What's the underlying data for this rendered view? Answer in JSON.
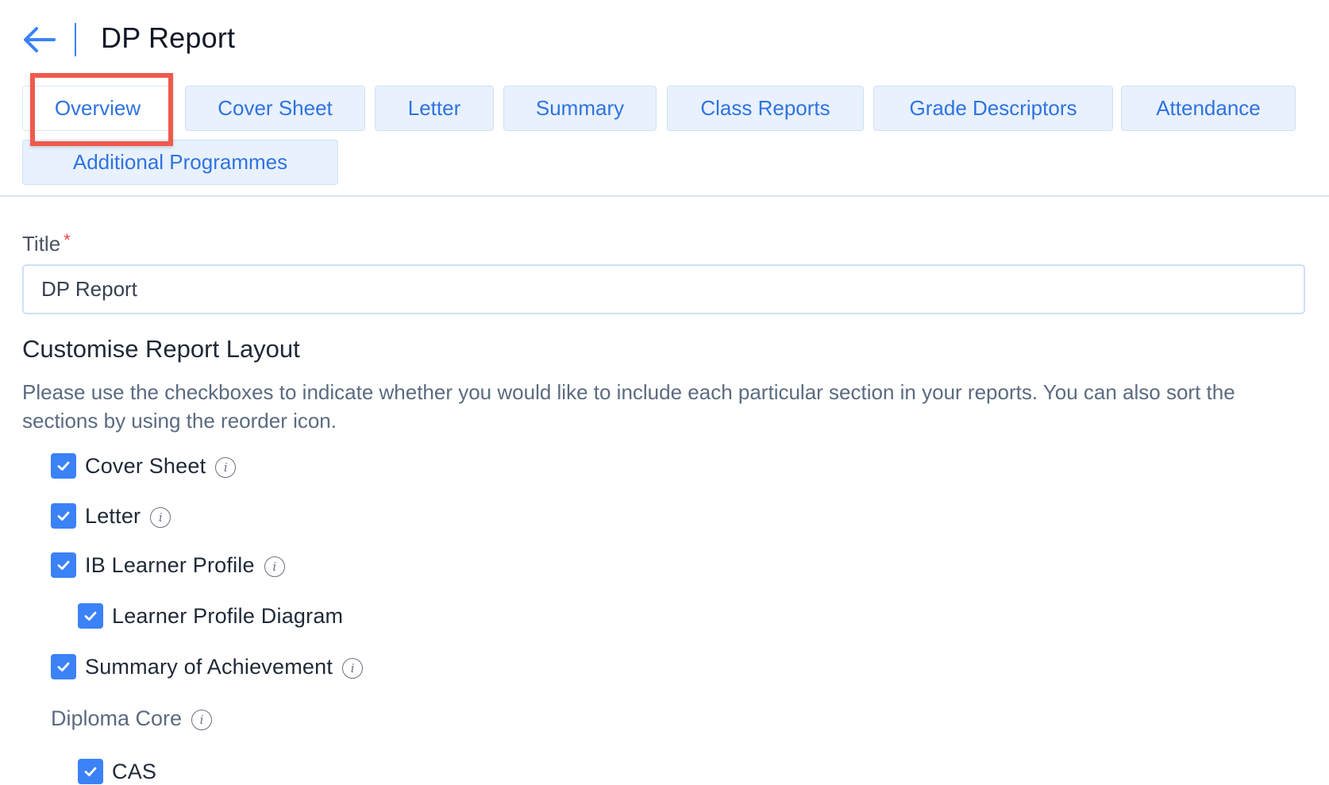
{
  "header": {
    "back_icon": "arrow-left-icon",
    "title": "DP Report"
  },
  "tabs": [
    {
      "label": "Overview",
      "active": true
    },
    {
      "label": "Cover Sheet",
      "active": false
    },
    {
      "label": "Letter",
      "active": false
    },
    {
      "label": "Summary",
      "active": false
    },
    {
      "label": "Class Reports",
      "active": false
    },
    {
      "label": "Grade Descriptors",
      "active": false
    },
    {
      "label": "Attendance",
      "active": false
    },
    {
      "label": "Additional Programmes",
      "active": false
    }
  ],
  "form": {
    "title_label": "Title",
    "required_marker": "*",
    "title_value": "DP Report"
  },
  "layout": {
    "heading": "Customise Report Layout",
    "description": "Please use the checkboxes to indicate whether you would like to include each particular section in your reports. You can also sort the sections by using the reorder icon.",
    "items": [
      {
        "label": "Cover Sheet",
        "checked": true,
        "info": true
      },
      {
        "label": "Letter",
        "checked": true,
        "info": true
      },
      {
        "label": "IB Learner Profile",
        "checked": true,
        "info": true
      },
      {
        "label": "Learner Profile Diagram",
        "checked": true,
        "info": false
      },
      {
        "label": "Summary of Achievement",
        "checked": true,
        "info": true
      },
      {
        "label": "Diploma Core",
        "info": true
      },
      {
        "label": "CAS",
        "checked": true,
        "info": false
      }
    ]
  },
  "colors": {
    "accent": "#3b82f6",
    "tab_bg": "#e8f1fd",
    "tab_text": "#2f73e0",
    "highlight": "#ef5a4c",
    "required": "#ef4444"
  }
}
